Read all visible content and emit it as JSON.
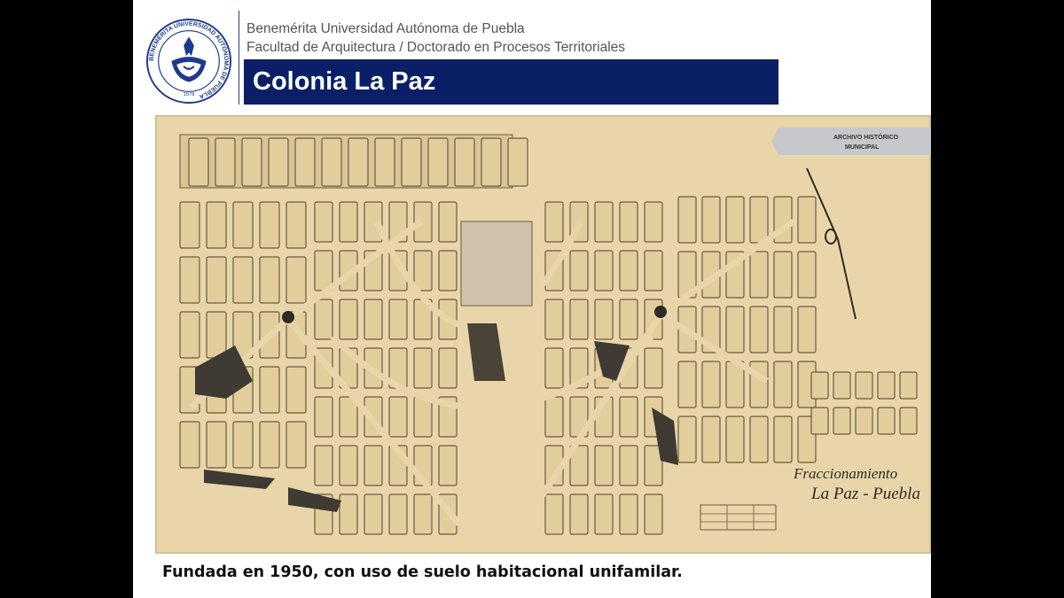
{
  "header": {
    "university": "Benemérita Universidad Autónoma de Puebla",
    "faculty": "Facultad de Arquitectura / Doctorado en Procesos Territoriales"
  },
  "seal": {
    "ring_text": "BENEMÉRITA UNIVERSIDAD AUTÓNOMA DE PUEBLA",
    "year": "1578"
  },
  "slide_title": "Colonia La Paz",
  "map": {
    "archive_label_line1": "ARCHIVO HISTÓRICO",
    "archive_label_line2": "MUNICIPAL",
    "plan_title_line1": "Fraccionamiento",
    "plan_title_line2": "La Paz - Puebla"
  },
  "caption": "Fundada en 1950, con uso de suelo habitacional unifamilar.",
  "colors": {
    "title_bar": "#0a1f66",
    "paper": "#e6d3a6",
    "ink": "#5a4a33"
  }
}
